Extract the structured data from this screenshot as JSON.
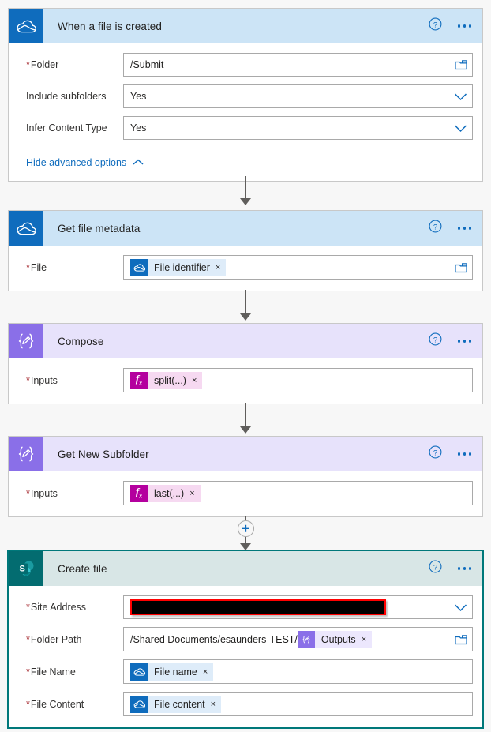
{
  "flow": {
    "steps": [
      {
        "id": "trigger",
        "title": "When a file is created",
        "connector": "onedrive",
        "icon": "onedrive-cloud-icon",
        "help_icon": "help-circle-icon",
        "menu_icon": "ellipsis-icon",
        "fields": [
          {
            "label": "Folder",
            "required": true,
            "value": "/Submit",
            "trailing_icon": "folder-picker-icon"
          },
          {
            "label": "Include subfolders",
            "required": false,
            "value": "Yes",
            "trailing_icon": "chevron-down-icon"
          },
          {
            "label": "Infer Content Type",
            "required": false,
            "value": "Yes",
            "trailing_icon": "chevron-down-icon"
          }
        ],
        "advanced_link": {
          "label": "Hide advanced options",
          "icon": "chevron-up-icon"
        }
      },
      {
        "id": "get-file-metadata",
        "title": "Get file metadata",
        "connector": "onedrive",
        "icon": "onedrive-cloud-icon",
        "help_icon": "help-circle-icon",
        "menu_icon": "ellipsis-icon",
        "fields": [
          {
            "label": "File",
            "required": true,
            "token": {
              "kind": "onedrive",
              "icon": "onedrive-cloud-icon",
              "label": "File identifier",
              "remove": "×"
            },
            "trailing_icon": "folder-picker-icon"
          }
        ]
      },
      {
        "id": "compose",
        "title": "Compose",
        "connector": "compose",
        "icon": "compose-braces-pencil-icon",
        "help_icon": "help-circle-icon",
        "menu_icon": "ellipsis-icon",
        "fields": [
          {
            "label": "Inputs",
            "required": true,
            "token": {
              "kind": "fx",
              "icon": "function-fx-icon",
              "label": "split(...)",
              "remove": "×"
            }
          }
        ]
      },
      {
        "id": "get-new-subfolder",
        "title": "Get New Subfolder",
        "connector": "compose",
        "icon": "compose-braces-pencil-icon",
        "help_icon": "help-circle-icon",
        "menu_icon": "ellipsis-icon",
        "fields": [
          {
            "label": "Inputs",
            "required": true,
            "token": {
              "kind": "fx",
              "icon": "function-fx-icon",
              "label": "last(...)",
              "remove": "×"
            }
          }
        ]
      },
      {
        "id": "create-file",
        "title": "Create file",
        "connector": "sharepoint",
        "icon": "sharepoint-icon",
        "help_icon": "help-circle-icon",
        "menu_icon": "ellipsis-icon",
        "selected": true,
        "fields": [
          {
            "label": "Site Address",
            "required": true,
            "redacted": true,
            "value": "",
            "trailing_icon": "chevron-down-icon"
          },
          {
            "label": "Folder Path",
            "required": true,
            "value": "/Shared Documents/esaunders-TEST/",
            "token": {
              "kind": "compose",
              "icon": "compose-braces-icon",
              "label": "Outputs",
              "remove": "×"
            },
            "trailing_icon": "folder-picker-icon"
          },
          {
            "label": "File Name",
            "required": true,
            "token": {
              "kind": "onedrive",
              "icon": "onedrive-cloud-icon",
              "label": "File name",
              "remove": "×"
            }
          },
          {
            "label": "File Content",
            "required": true,
            "token": {
              "kind": "onedrive",
              "icon": "onedrive-cloud-icon",
              "label": "File content",
              "remove": "×"
            }
          }
        ]
      }
    ],
    "insert_step_button": {
      "icon": "plus-icon",
      "label": "+"
    }
  },
  "colors": {
    "onedrive_blue": "#0f6cbd",
    "onedrive_header": "#cce4f6",
    "compose_purple": "#8a6fe8",
    "compose_header": "#e7e2fb",
    "sharepoint_teal": "#036c70",
    "sharepoint_header": "#d8e6e6",
    "selected_border": "#00787a",
    "required_asterisk": "#a4262c",
    "link_blue": "#0f6cbd",
    "redaction_fill": "#000000",
    "redaction_outline": "#ff0000",
    "canvas_background": "#f7f7f7"
  }
}
